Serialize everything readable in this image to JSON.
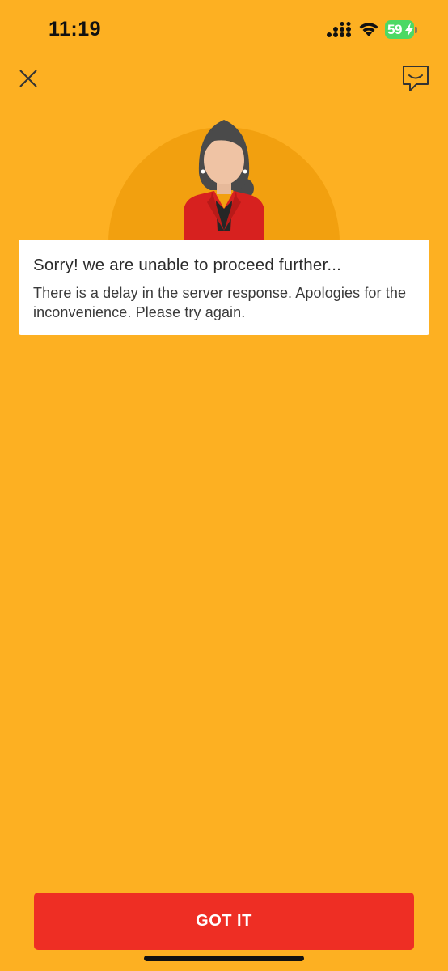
{
  "status_bar": {
    "time": "11:19",
    "battery_level": "59",
    "icons": [
      "signal-icon",
      "wifi-icon",
      "battery-icon"
    ]
  },
  "header": {
    "close_icon": "close-icon",
    "chat_icon": "chat-icon"
  },
  "illustration": {
    "icon": "support-agent-avatar"
  },
  "message": {
    "title": "Sorry! we are unable to proceed further...",
    "body": "There is a delay in the server response. Apologies for the inconvenience. Please try again."
  },
  "footer": {
    "button_label": "GOT IT"
  },
  "colors": {
    "background": "#FDB022",
    "circle": "#F2A00F",
    "primary_button": "#EE2E24",
    "card": "#FFFFFF",
    "battery": "#4CD964"
  }
}
